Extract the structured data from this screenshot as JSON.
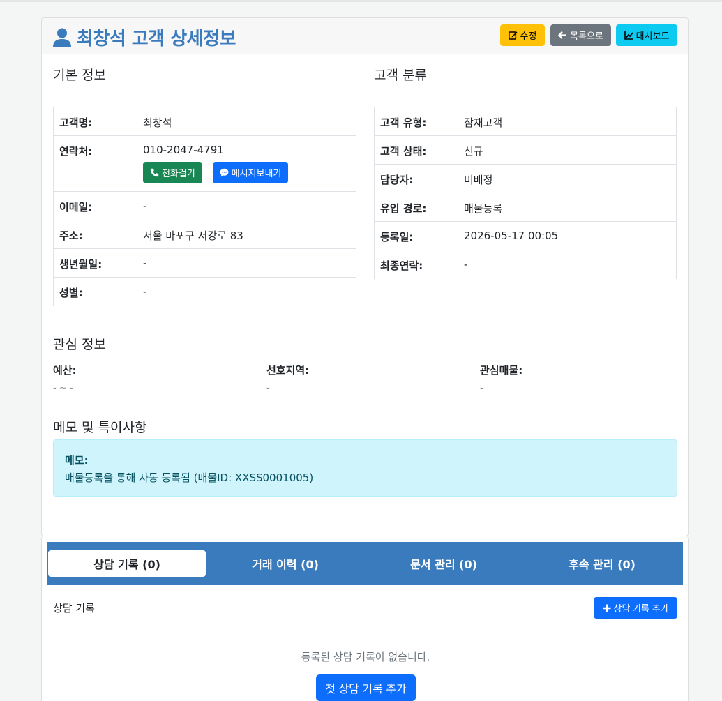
{
  "header": {
    "title": "최창석 고객 상세정보",
    "buttons": {
      "edit": "수정",
      "list": "목록으로",
      "dashboard": "대시보드"
    }
  },
  "basic": {
    "section_title": "기본 정보",
    "rows": [
      {
        "label": "고객명:",
        "value": "최창석"
      },
      {
        "label": "연락처:",
        "value": "010-2047-4791"
      },
      {
        "label": "이메일:",
        "value": "-"
      },
      {
        "label": "주소:",
        "value": "서울 마포구 서강로 83"
      },
      {
        "label": "생년월일:",
        "value": "-"
      },
      {
        "label": "성별:",
        "value": "-"
      }
    ],
    "call_button": "전화걸기",
    "message_button": "메시지보내기"
  },
  "classification": {
    "section_title": "고객 분류",
    "rows": [
      {
        "label": "고객 유형:",
        "value": "잠재고객"
      },
      {
        "label": "고객 상태:",
        "value": "신규"
      },
      {
        "label": "담당자:",
        "value": "미배정"
      },
      {
        "label": "유입 경로:",
        "value": "매물등록"
      },
      {
        "label": "등록일:",
        "value": "2026-05-17 00:05"
      },
      {
        "label": "최종연락:",
        "value": "-"
      }
    ]
  },
  "interest": {
    "section_title": "관심 정보",
    "items": [
      {
        "label": "예산:",
        "value": "- ~ -"
      },
      {
        "label": "선호지역:",
        "value": "-"
      },
      {
        "label": "관심매물:",
        "value": "-"
      }
    ]
  },
  "memo": {
    "section_title": "메모 및 특이사항",
    "label": "메모:",
    "text": "매물등록을 통해 자동 등록됨 (매물ID: XXSS0001005)"
  },
  "tabs": [
    {
      "label": "상담 기록 (0)",
      "active": true
    },
    {
      "label": "거래 이력 (0)",
      "active": false
    },
    {
      "label": "문서 관리 (0)",
      "active": false
    },
    {
      "label": "후속 관리 (0)",
      "active": false
    }
  ],
  "consultation": {
    "title": "상담 기록",
    "add_button": "상담 기록 추가",
    "empty_text": "등록된 상담 기록이 없습니다.",
    "first_button": "첫 상담 기록 추가"
  },
  "colors": {
    "primary": "#3a7bbd",
    "warning": "#ffc107",
    "secondary": "#6c757d",
    "info": "#0dcaf0",
    "success": "#198754",
    "blue": "#0d6efd",
    "memo_bg": "#cff4fc"
  },
  "icons": {
    "title": "user-icon",
    "edit": "edit-icon",
    "list": "arrow-left-icon",
    "dashboard": "chart-line-icon",
    "call": "phone-icon",
    "message": "chat-icon",
    "add": "plus-icon"
  }
}
